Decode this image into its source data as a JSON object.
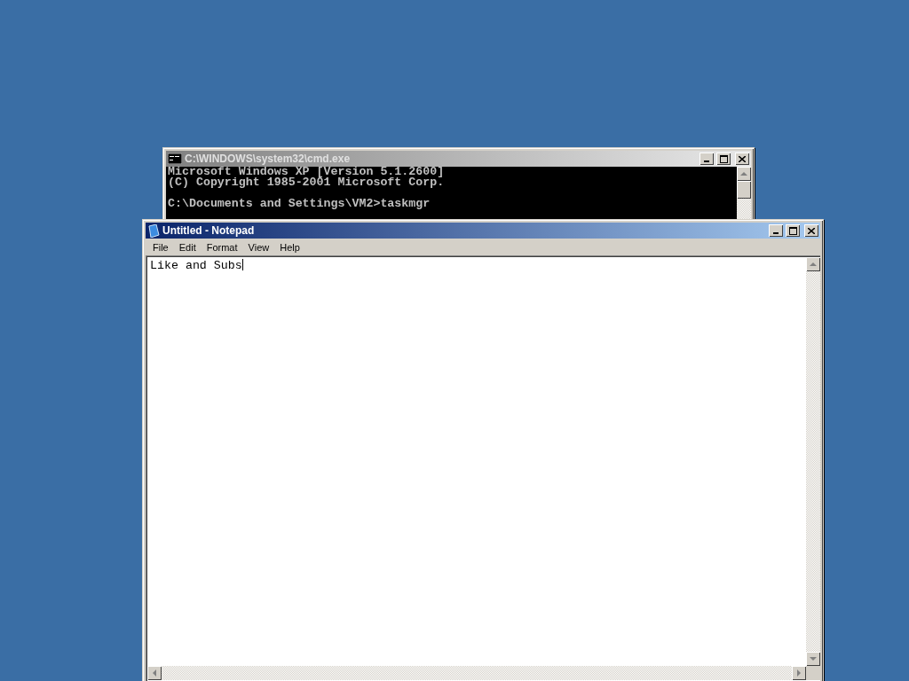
{
  "console_window": {
    "title": "C:\\WINDOWS\\system32\\cmd.exe",
    "active": false,
    "blocks": [
      [
        "Microsoft Windows XP [Version 5.1.2600]",
        "(C) Copyright 1985-2001 Microsoft Corp."
      ],
      [
        "C:\\Documents and Settings\\VM2>taskmgr"
      ]
    ]
  },
  "notepad_window": {
    "title": "Untitled - Notepad",
    "active": true,
    "menu": [
      "File",
      "Edit",
      "Format",
      "View",
      "Help"
    ],
    "text": "Like and Subs"
  }
}
